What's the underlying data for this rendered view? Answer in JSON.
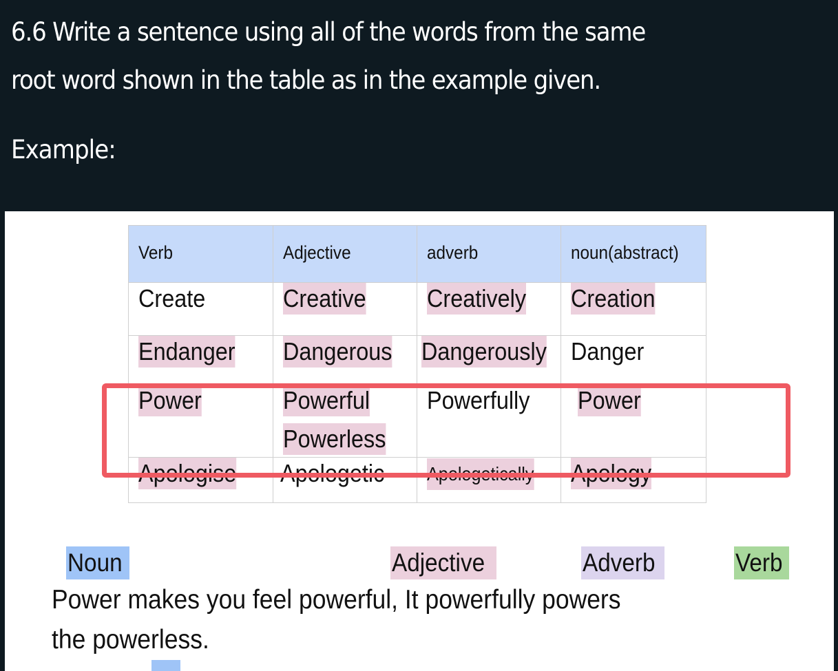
{
  "question": {
    "lines": [
      "6.6 Write a sentence using all of the words from the same",
      "root word shown in the table as in the example given."
    ],
    "example_label": "Example:"
  },
  "table": {
    "headers": [
      "Verb",
      "Adjective",
      "adverb",
      "noun(abstract)"
    ],
    "rows": [
      {
        "verb": {
          "text": "Create",
          "highlight": null
        },
        "adjective": [
          {
            "text": "Creative",
            "highlight": "pink"
          }
        ],
        "adverb": {
          "text": "Creatively",
          "highlight": "pink"
        },
        "noun": {
          "text": "Creation",
          "highlight": "pink"
        }
      },
      {
        "verb": {
          "text": "Endanger",
          "highlight": "pink"
        },
        "adjective": [
          {
            "text": "Dangerous",
            "highlight": "pink"
          }
        ],
        "adverb": {
          "text": "Dangerously",
          "highlight": "pink"
        },
        "noun": {
          "text": "Danger",
          "highlight": null
        }
      },
      {
        "verb": {
          "text": "Power",
          "highlight": "pink"
        },
        "adjective": [
          {
            "text": "Powerful",
            "highlight": "pink"
          },
          {
            "text": "Powerless",
            "highlight": "pink"
          }
        ],
        "adverb": {
          "text": "Powerfully",
          "highlight": null
        },
        "noun": {
          "text": "Power",
          "highlight": "pink"
        },
        "outlined": true
      },
      {
        "verb": {
          "text": "Apologise",
          "highlight": "pink"
        },
        "adjective": [
          {
            "text": "Apologetic",
            "highlight": null
          }
        ],
        "adverb": {
          "text": "Apologetically",
          "highlight": "pink"
        },
        "noun": {
          "text": "Apology",
          "highlight": "pink"
        }
      }
    ]
  },
  "legend": {
    "noun": "Noun",
    "adjective": "Adjective",
    "adverb": "Adverb",
    "verb": "Verb"
  },
  "sentence": {
    "lines": [
      "Power makes you feel powerful, It powerfully powers",
      "the powerless."
    ]
  },
  "colors": {
    "background": "#0e1a21",
    "header_fill": "#c6dafa",
    "pink_highlight": "#ecd0dd",
    "noun_tag": "#9fc4f7",
    "adverb_tag": "#dcd4ee",
    "verb_tag": "#a9d89c",
    "outline": "#ef5a62"
  }
}
